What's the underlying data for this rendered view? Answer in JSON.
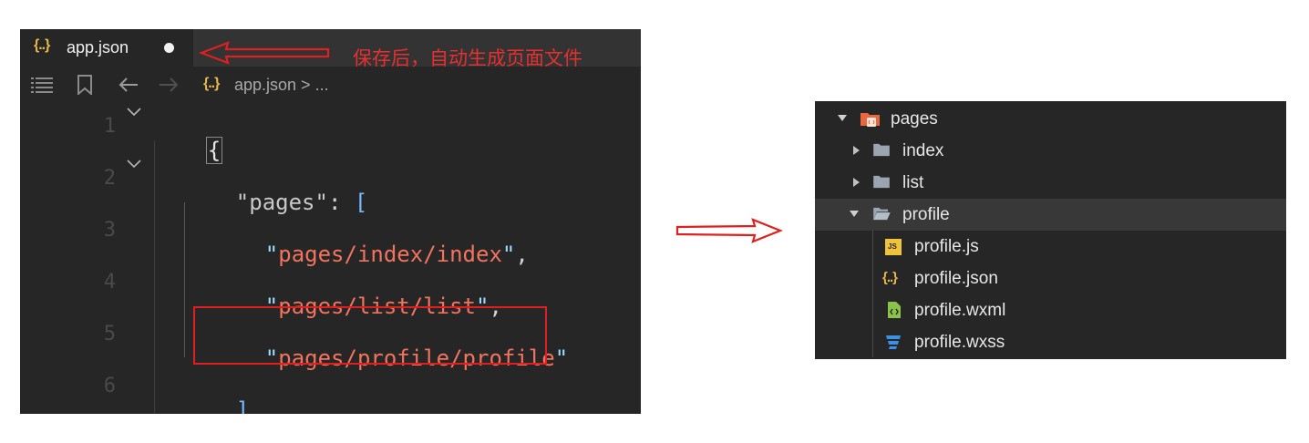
{
  "editor": {
    "tab": {
      "icon": "json-braces-icon",
      "icon_text": "{..}",
      "filename": "app.json",
      "dirty": true
    },
    "breadcrumb": {
      "icon_text": "{..}",
      "text": "app.json > ..."
    },
    "lines": [
      "1",
      "2",
      "3",
      "4",
      "5",
      "6"
    ],
    "code": {
      "line1_brace": "{",
      "line2_key": "\"pages\"",
      "line2_colon": ": ",
      "line2_bracket": "[",
      "line3_value": "pages/index/index",
      "line4_value": "pages/list/list",
      "line5_value": "pages/profile/profile",
      "comma": ",",
      "line6_close": "],",
      "quote": "\""
    }
  },
  "annotation": {
    "text": "保存后，自动生成页面文件",
    "color": "#e53030"
  },
  "explorer": {
    "items": [
      {
        "label": "pages",
        "icon": "pages-folder-icon",
        "expanded": true
      },
      {
        "label": "index",
        "icon": "folder-icon",
        "expanded": false
      },
      {
        "label": "list",
        "icon": "folder-icon",
        "expanded": false
      },
      {
        "label": "profile",
        "icon": "folder-open-icon",
        "expanded": true,
        "selected": true
      },
      {
        "label": "profile.js",
        "icon": "js-file-icon",
        "icon_text": "JS"
      },
      {
        "label": "profile.json",
        "icon": "json-file-icon",
        "icon_text": "{..}"
      },
      {
        "label": "profile.wxml",
        "icon": "wxml-file-icon"
      },
      {
        "label": "profile.wxss",
        "icon": "css-file-icon"
      }
    ]
  },
  "colors": {
    "editor_bg": "#262626",
    "string": "#f2735e",
    "arrow": "#e02020",
    "highlight": "#e02020"
  }
}
